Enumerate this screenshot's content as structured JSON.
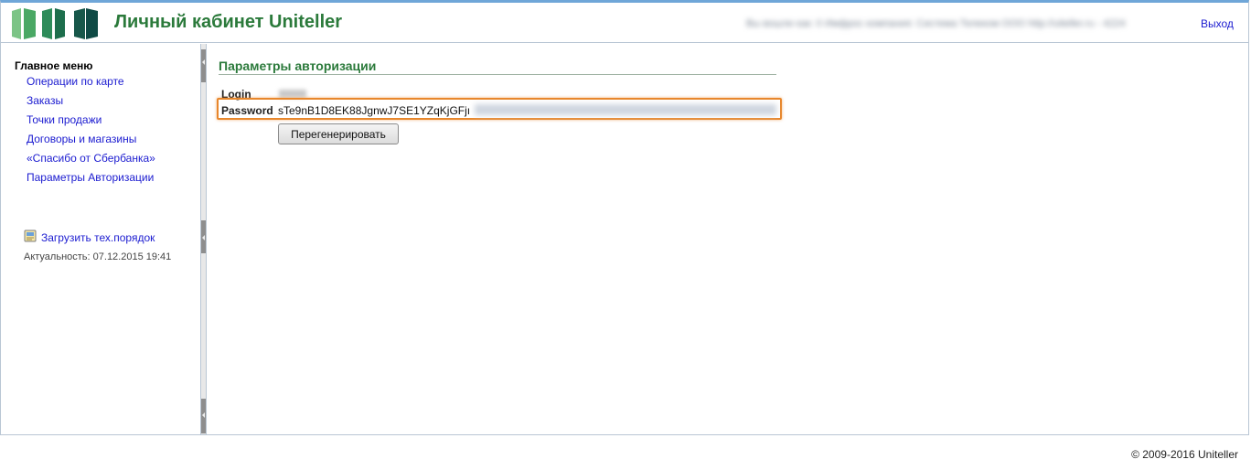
{
  "header": {
    "app_title": "Личный кабинет Uniteller",
    "user_info": "Вы вошли как: 0 Имфрос компания: Система Телеком ООО http://uiteller.ru - 4224",
    "logout_label": "Выход"
  },
  "sidebar": {
    "menu_title": "Главное меню",
    "items": [
      {
        "label": "Операции по карте"
      },
      {
        "label": "Заказы"
      },
      {
        "label": "Точки продажи"
      },
      {
        "label": "Договоры и магазины"
      },
      {
        "label": "«Спасибо от Сбербанка»"
      },
      {
        "label": "Параметры Авторизации"
      }
    ],
    "upload_label": "Загрузить тех.порядок",
    "actuality": "Актуальность: 07.12.2015 19:41"
  },
  "main": {
    "section_title": "Параметры авторизации",
    "login_label": "Login",
    "password_label": "Password",
    "password_value": "sTe9nB1D8EK88JgnwJ7SE1YZqKjGFjı",
    "regenerate_label": "Перегенерировать"
  },
  "footer": {
    "copyright": "© 2009-2016 Uniteller"
  },
  "colors": {
    "brand_green": "#2b7a3b",
    "link_blue": "#1b1bd0",
    "highlight_orange": "#e8872c",
    "top_border_blue": "#6fa6d8"
  },
  "icons": [
    "uniteller-logo",
    "upload-document-icon",
    "collapse-arrow-icon"
  ]
}
